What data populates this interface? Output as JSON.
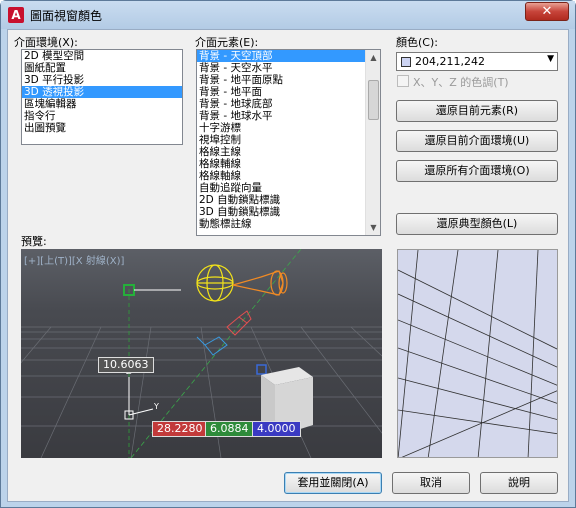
{
  "window": {
    "title": "圖面視窗顏色",
    "close_symbol": "✕",
    "app_icon": "A"
  },
  "context_label": "介面環境(X):",
  "contexts": [
    {
      "label": "2D 模型空間",
      "selected": false
    },
    {
      "label": "圖紙配置",
      "selected": false
    },
    {
      "label": "3D 平行投影",
      "selected": false
    },
    {
      "label": "3D 透視投影",
      "selected": true
    },
    {
      "label": "區塊編輯器",
      "selected": false
    },
    {
      "label": "指令行",
      "selected": false
    },
    {
      "label": "出圖預覽",
      "selected": false
    }
  ],
  "element_label": "介面元素(E):",
  "elements": [
    {
      "label": "背景 - 天空頂部",
      "selected": true
    },
    {
      "label": "背景 - 天空水平",
      "selected": false
    },
    {
      "label": "背景 - 地平面原點",
      "selected": false
    },
    {
      "label": "背景 - 地平面",
      "selected": false
    },
    {
      "label": "背景 - 地球底部",
      "selected": false
    },
    {
      "label": "背景 - 地球水平",
      "selected": false
    },
    {
      "label": "十字游標",
      "selected": false
    },
    {
      "label": "視埠控制",
      "selected": false
    },
    {
      "label": "格線主線",
      "selected": false
    },
    {
      "label": "格線輔線",
      "selected": false
    },
    {
      "label": "格線軸線",
      "selected": false
    },
    {
      "label": "自動追蹤向量",
      "selected": false
    },
    {
      "label": "2D 自動鎖點標識",
      "selected": false
    },
    {
      "label": "3D 自動鎖點標識",
      "selected": false
    },
    {
      "label": "動態標註線",
      "selected": false
    }
  ],
  "color": {
    "label": "顏色(C):",
    "value": "204,211,242",
    "swatch": "#ccd3f2"
  },
  "tint_checkbox": {
    "label": "X、Y、Z 的色調(T)",
    "checked": false
  },
  "buttons": {
    "restore_element": "還原目前元素(R)",
    "restore_context": "還原目前介面環境(U)",
    "restore_all": "還原所有介面環境(O)",
    "restore_classic": "還原典型顏色(L)",
    "apply_close": "套用並關閉(A)",
    "cancel": "取消",
    "help": "說明"
  },
  "preview": {
    "label": "預覽:",
    "viewport_label": "[+][上(T)][X 射線(X)]",
    "dim_value": "10.6063",
    "coord_x": "28.2280",
    "coord_y": "6.0884",
    "coord_z": "4.0000",
    "coord_x_color": "#c23a3a",
    "coord_y_color": "#2e8b3a",
    "coord_z_color": "#3a3ac2",
    "axis_z": "Z",
    "axis_y": "Y"
  }
}
